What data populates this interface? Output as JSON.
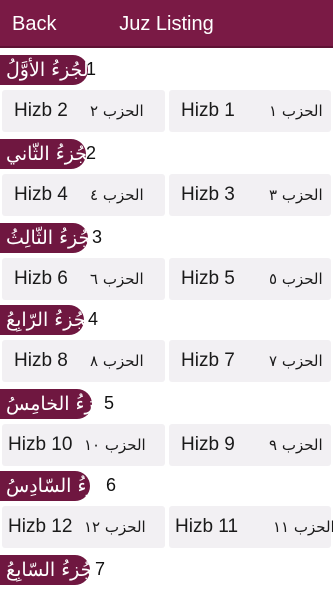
{
  "nav": {
    "back_label": "Back",
    "title": "Juz Listing"
  },
  "juz": [
    {
      "number": "1",
      "name_ar": "الجُزءُ الأوَّلُ",
      "hizb": [
        {
          "en": "Hizb 2",
          "ar": "الحزب ٢"
        },
        {
          "en": "Hizb 1",
          "ar": "الحزب ١"
        }
      ]
    },
    {
      "number": "2",
      "name_ar": "الجُزءُ الثّاني",
      "hizb": [
        {
          "en": "Hizb 4",
          "ar": "الحزب ٤"
        },
        {
          "en": "Hizb 3",
          "ar": "الحزب ٣"
        }
      ]
    },
    {
      "number": "3",
      "name_ar": "الجُزءُ الثّالِثُ",
      "hizb": [
        {
          "en": "Hizb 6",
          "ar": "الحزب ٦"
        },
        {
          "en": "Hizb 5",
          "ar": "الحزب ٥"
        }
      ]
    },
    {
      "number": "4",
      "name_ar": "الجُزءُ الرّابِعُ",
      "hizb": [
        {
          "en": "Hizb 8",
          "ar": "الحزب ٨"
        },
        {
          "en": "Hizb 7",
          "ar": "الحزب ٧"
        }
      ]
    },
    {
      "number": "5",
      "name_ar": "الجُزءُ الخامِسُ",
      "hizb": [
        {
          "en": "Hizb 10",
          "ar": "الحزب ١٠"
        },
        {
          "en": "Hizb 9",
          "ar": "الحزب ٩"
        }
      ]
    },
    {
      "number": "6",
      "name_ar": "الجُزءُ السّادِسُ",
      "hizb": [
        {
          "en": "Hizb 12",
          "ar": "الحزب ١٢"
        },
        {
          "en": "Hizb 11",
          "ar": "الحزب ١١"
        }
      ]
    },
    {
      "number": "7",
      "name_ar": "الجُزءُ السّابِعُ",
      "hizb": []
    }
  ]
}
